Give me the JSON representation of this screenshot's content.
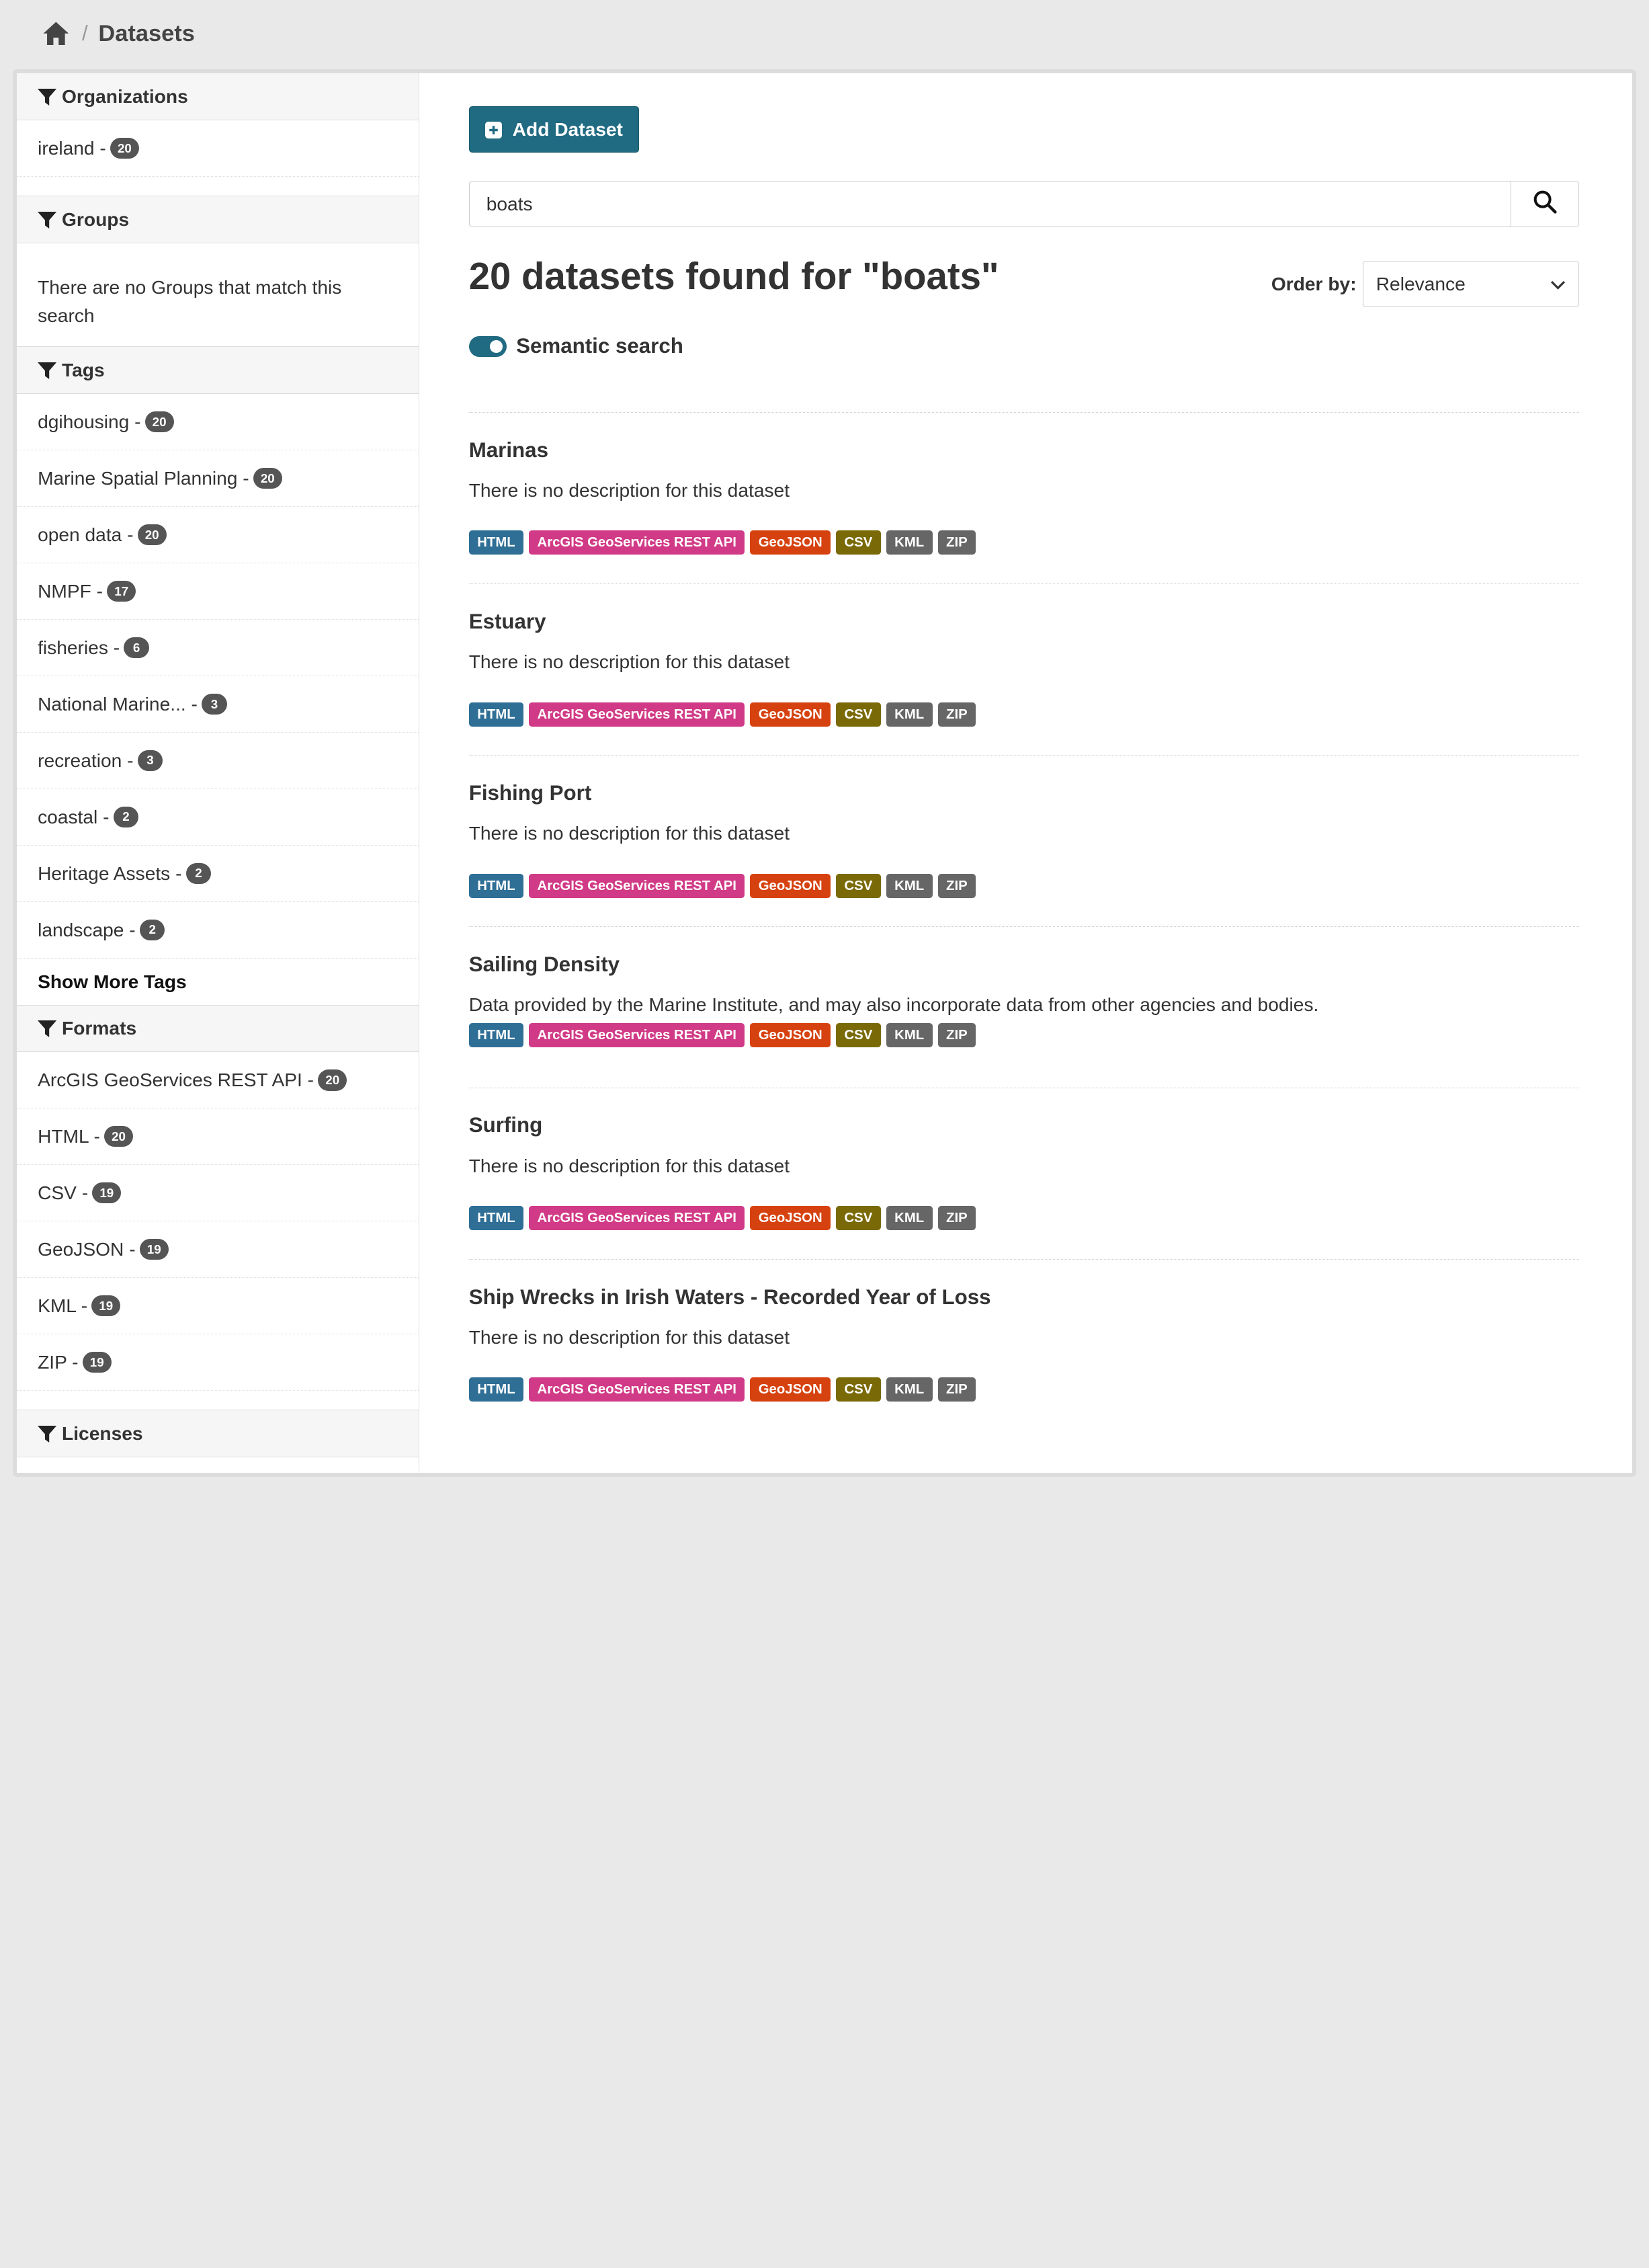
{
  "breadcrumb": {
    "current": "Datasets"
  },
  "sidebar": {
    "organizations": {
      "title": "Organizations",
      "items": [
        {
          "label": "ireland - ",
          "count": "20"
        }
      ]
    },
    "groups": {
      "title": "Groups",
      "empty": "There are no Groups that match this search"
    },
    "tags": {
      "title": "Tags",
      "items": [
        {
          "label": "dgihousing - ",
          "count": "20"
        },
        {
          "label": "Marine Spatial Planning - ",
          "count": "20"
        },
        {
          "label": "open data - ",
          "count": "20"
        },
        {
          "label": "NMPF - ",
          "count": "17"
        },
        {
          "label": "fisheries - ",
          "count": "6"
        },
        {
          "label": "National Marine... - ",
          "count": "3"
        },
        {
          "label": "recreation - ",
          "count": "3"
        },
        {
          "label": "coastal - ",
          "count": "2"
        },
        {
          "label": "Heritage Assets - ",
          "count": "2"
        },
        {
          "label": "landscape - ",
          "count": "2"
        }
      ],
      "show_more": "Show More Tags"
    },
    "formats": {
      "title": "Formats",
      "items": [
        {
          "label": "ArcGIS GeoServices REST API - ",
          "count": "20"
        },
        {
          "label": "HTML - ",
          "count": "20"
        },
        {
          "label": "CSV - ",
          "count": "19"
        },
        {
          "label": "GeoJSON - ",
          "count": "19"
        },
        {
          "label": "KML - ",
          "count": "19"
        },
        {
          "label": "ZIP - ",
          "count": "19"
        }
      ]
    },
    "licenses": {
      "title": "Licenses"
    }
  },
  "main": {
    "add_button": "Add Dataset",
    "search_value": "boats",
    "results_title": "20 datasets found for \"boats\"",
    "order_label": "Order by:",
    "order_value": "Relevance",
    "semantic_label": "Semantic search",
    "semantic_on": true
  },
  "format_colors": {
    "HTML": "#2f6f96",
    "ArcGIS GeoServices REST API": "#d13a86",
    "GeoJSON": "#d6420f",
    "CSV": "#7a6a07",
    "KML": "#666666",
    "ZIP": "#666666"
  },
  "results": [
    {
      "title": "Marinas",
      "desc": "There is no description for this dataset",
      "formats": [
        "HTML",
        "ArcGIS GeoServices REST API",
        "GeoJSON",
        "CSV",
        "KML",
        "ZIP"
      ]
    },
    {
      "title": "Estuary",
      "desc": "There is no description for this dataset",
      "formats": [
        "HTML",
        "ArcGIS GeoServices REST API",
        "GeoJSON",
        "CSV",
        "KML",
        "ZIP"
      ]
    },
    {
      "title": "Fishing Port",
      "desc": "There is no description for this dataset",
      "formats": [
        "HTML",
        "ArcGIS GeoServices REST API",
        "GeoJSON",
        "CSV",
        "KML",
        "ZIP"
      ]
    },
    {
      "title": "Sailing Density",
      "desc": "Data provided by the Marine Institute, and may also incorporate data from other agencies and bodies.",
      "formats": [
        "HTML",
        "ArcGIS GeoServices REST API",
        "GeoJSON",
        "CSV",
        "KML",
        "ZIP"
      ]
    },
    {
      "title": "Surfing",
      "desc": "There is no description for this dataset",
      "formats": [
        "HTML",
        "ArcGIS GeoServices REST API",
        "GeoJSON",
        "CSV",
        "KML",
        "ZIP"
      ]
    },
    {
      "title": "Ship Wrecks in Irish Waters - Recorded Year of Loss",
      "desc": "There is no description for this dataset",
      "formats": [
        "HTML",
        "ArcGIS GeoServices REST API",
        "GeoJSON",
        "CSV",
        "KML",
        "ZIP"
      ]
    }
  ]
}
